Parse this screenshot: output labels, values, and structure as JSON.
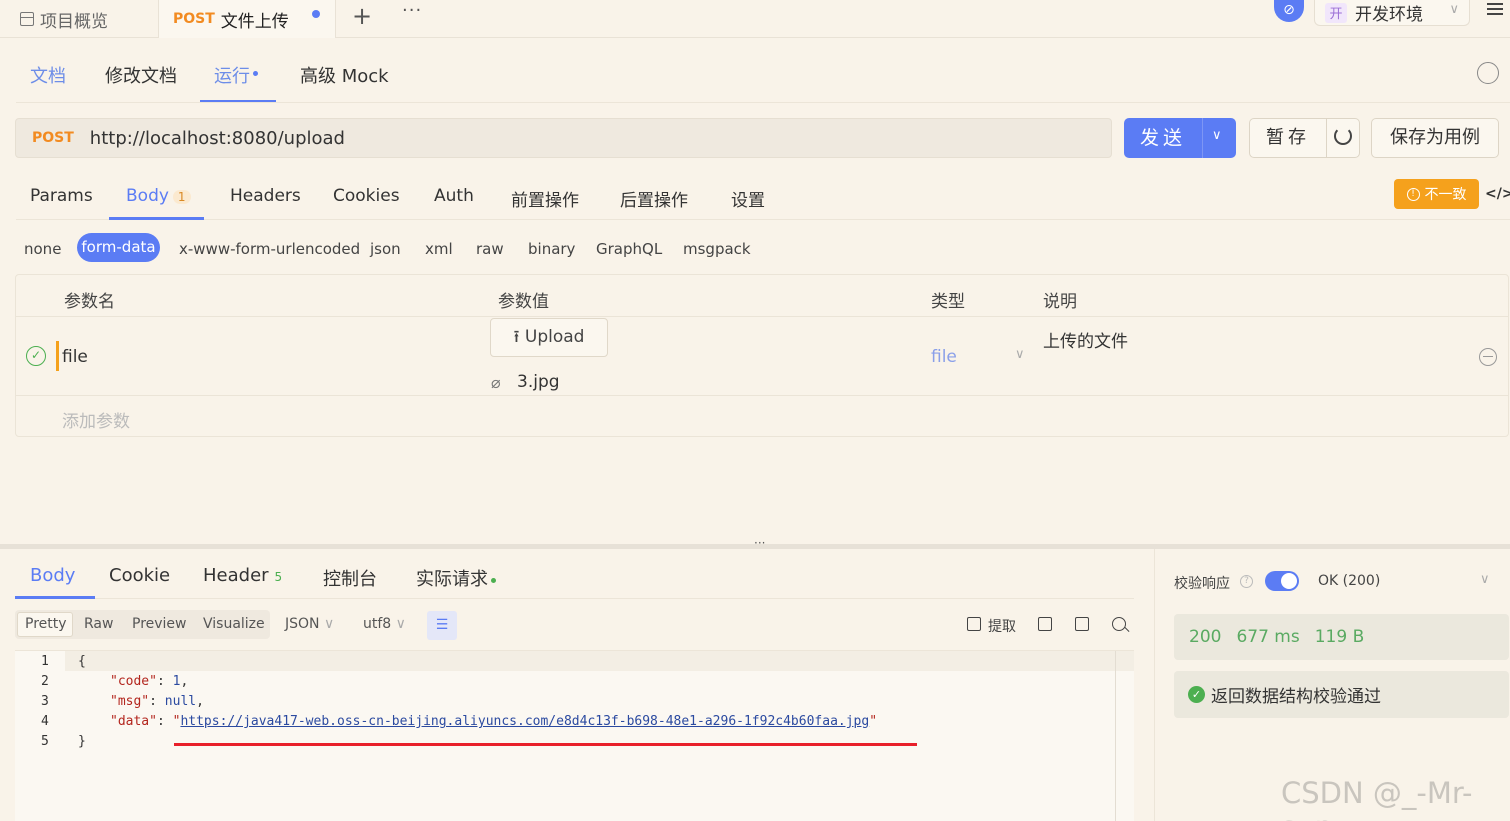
{
  "tabs": {
    "overview": "项目概览",
    "active_method": "POST",
    "active_title": "文件上传",
    "plus": "+",
    "more": "···"
  },
  "env": {
    "badge": "开",
    "name": "开发环境"
  },
  "doc_nav": [
    "文档",
    "修改文档",
    "运行",
    "高级 Mock"
  ],
  "request": {
    "method": "POST",
    "url": "http://localhost:8080/upload",
    "send": "发送",
    "save_temp": "暂存",
    "save_case": "保存为用例"
  },
  "req_tabs": {
    "params": "Params",
    "body": "Body",
    "body_count": "1",
    "headers": "Headers",
    "cookies": "Cookies",
    "auth": "Auth",
    "pre": "前置操作",
    "post": "后置操作",
    "settings": "设置"
  },
  "warning": "不一致",
  "body_types": [
    "none",
    "form-data",
    "x-www-form-urlencoded",
    "json",
    "xml",
    "raw",
    "binary",
    "GraphQL",
    "msgpack"
  ],
  "params_table": {
    "headers": [
      "参数名",
      "参数值",
      "类型",
      "说明"
    ],
    "rows": [
      {
        "name": "file",
        "upload": "Upload",
        "filename": "3.jpg",
        "type": "file",
        "desc": "上传的文件"
      }
    ],
    "add": "添加参数"
  },
  "response": {
    "tabs": {
      "body": "Body",
      "cookie": "Cookie",
      "header": "Header",
      "header_count": "5",
      "console": "控制台",
      "actual": "实际请求"
    },
    "views": [
      "Pretty",
      "Raw",
      "Preview",
      "Visualize"
    ],
    "format": "JSON",
    "encoding": "utf8",
    "extract": "提取",
    "lines": [
      "1",
      "2",
      "3",
      "4",
      "5"
    ],
    "code": {
      "open": "{",
      "k1": "\"code\"",
      "v1": "1",
      "k2": "\"msg\"",
      "v2": "null",
      "k3": "\"data\"",
      "v3": "https://java417-web.oss-cn-beijing.aliyuncs.com/e8d4c13f-b698-48e1-a296-1f92c4b60faa.jpg",
      "close": "}"
    }
  },
  "validate": {
    "label": "校验响应",
    "status": "OK (200)",
    "code": "200",
    "time": "677 ms",
    "size": "119 B",
    "pass": "返回数据结构校验通过"
  },
  "watermark": "CSDN @_-Mr-sun",
  "colors": {
    "accent": "#5b7cf4",
    "post": "#f28b21",
    "success": "#4caf50",
    "warning": "#f5a11c",
    "highlight": "#e8202a"
  }
}
